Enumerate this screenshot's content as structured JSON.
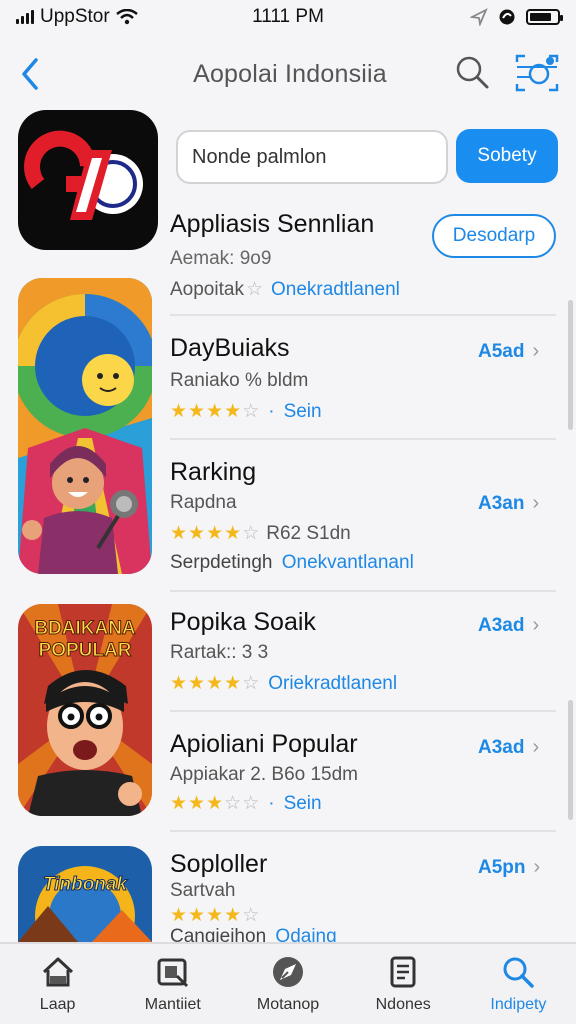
{
  "status": {
    "carrier": "UppStor",
    "time": "1111 PM"
  },
  "nav": {
    "title": "Aopolai Indonsiia"
  },
  "search": {
    "value": "Nonde palmlon",
    "button_label": "Sobety"
  },
  "featured": {
    "name": "Appliasis Sennlian",
    "subtitle": "Aemak: 9o9",
    "meta_text": "Aopoitak",
    "link_text": "Onekradtlanenl",
    "download_label": "Desodarp"
  },
  "apps": [
    {
      "title": "DayBuiaks",
      "subtitle": "Raniako % bldm",
      "rating_stars": 3.5,
      "link_text": "Sein",
      "action_label": "A5ad"
    },
    {
      "title": "Rarking",
      "subtitle": "Rapdna",
      "rating_stars": 3.5,
      "rating_extra": "R62 S1dn",
      "tertiary_label": "Serpdetingh",
      "tertiary_link": "Onekvantlananl",
      "action_label": "A3an"
    },
    {
      "title": "Popika Soaik",
      "subtitle": "Rartak:: 3 3",
      "rating_stars": 4,
      "link_text": "Oriekradtlanenl",
      "action_label": "A3ad",
      "icon_label_top": "BDAIKANA",
      "icon_label_bottom": "POPULAR"
    },
    {
      "title": "Apioliani Popular",
      "subtitle": "Appiakar 2. B6o 15dm",
      "rating_stars": 3,
      "link_text": "Sein",
      "action_label": "A3ad"
    },
    {
      "title": "Soploller",
      "subtitle": "Sartvah",
      "rating_stars": 4,
      "tertiary_label": "Cangieihon",
      "tertiary_link": "Odaing",
      "action_label": "A5pn",
      "icon_label": "Tinbonak"
    }
  ],
  "tabs": [
    {
      "label": "Laap",
      "icon": "home-icon"
    },
    {
      "label": "Mantiiet",
      "icon": "market-icon"
    },
    {
      "label": "Motanop",
      "icon": "compass-icon"
    },
    {
      "label": "Ndones",
      "icon": "document-icon"
    },
    {
      "label": "Indipety",
      "icon": "search-icon",
      "active": true
    }
  ],
  "colors": {
    "accent": "#1e88e5",
    "star": "#f5b81c",
    "background": "#f5f5f7"
  }
}
